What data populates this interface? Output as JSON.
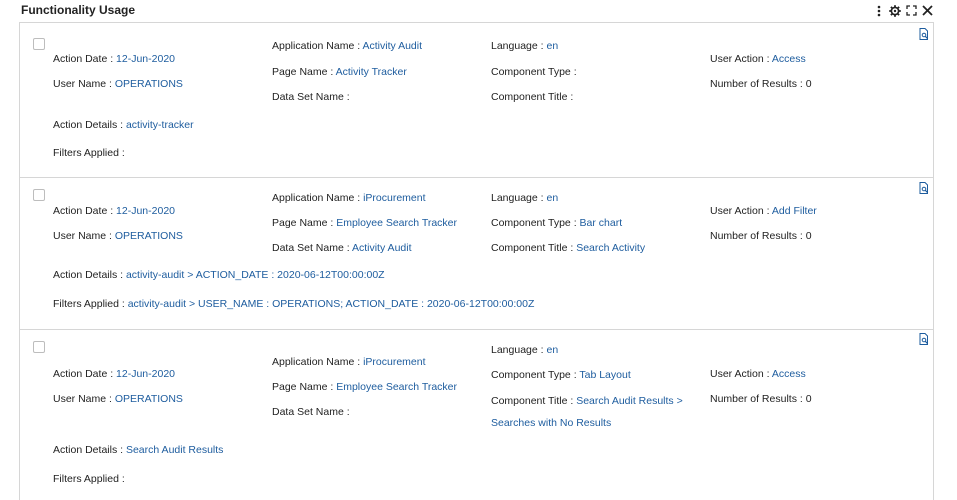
{
  "header": {
    "title": "Functionality Usage",
    "icons": [
      "more-vertical-icon",
      "settings-gear-icon",
      "expand-icon",
      "close-icon"
    ]
  },
  "labels": {
    "action_date": "Action Date :",
    "user_name": "User Name :",
    "action_details": "Action Details :",
    "filters_applied": "Filters Applied :",
    "application_name": "Application Name :",
    "page_name": "Page Name :",
    "data_set_name": "Data Set Name :",
    "language": "Language :",
    "component_type": "Component Type :",
    "component_title": "Component Title :",
    "user_action": "User Action :",
    "number_of_results": "Number of Results :"
  },
  "records": [
    {
      "action_date": "12-Jun-2020",
      "user_name": "OPERATIONS",
      "action_details": "activity-tracker",
      "filters_applied": "",
      "application_name": "Activity Audit",
      "page_name": "Activity Tracker",
      "data_set_name": "",
      "language": "en",
      "component_type": "",
      "component_title": "",
      "component_title_cont": "",
      "user_action": "Access",
      "number_of_results": "0"
    },
    {
      "action_date": "12-Jun-2020",
      "user_name": "OPERATIONS",
      "action_details": "activity-audit > ACTION_DATE : 2020-06-12T00:00:00Z",
      "filters_applied": "activity-audit > USER_NAME : OPERATIONS; ACTION_DATE : 2020-06-12T00:00:00Z",
      "application_name": "iProcurement",
      "page_name": "Employee Search Tracker",
      "data_set_name": "Activity Audit",
      "language": "en",
      "component_type": "Bar chart",
      "component_title": "Search Activity",
      "component_title_cont": "",
      "user_action": "Add Filter",
      "number_of_results": "0"
    },
    {
      "action_date": "12-Jun-2020",
      "user_name": "OPERATIONS",
      "action_details": "Search Audit Results",
      "filters_applied": "",
      "application_name": "iProcurement",
      "page_name": "Employee Search Tracker",
      "data_set_name": "",
      "language": "en",
      "component_type": "Tab Layout",
      "component_title": "Search Audit Results >",
      "component_title_cont": "Searches with No Results",
      "user_action": "Access",
      "number_of_results": "0"
    }
  ]
}
